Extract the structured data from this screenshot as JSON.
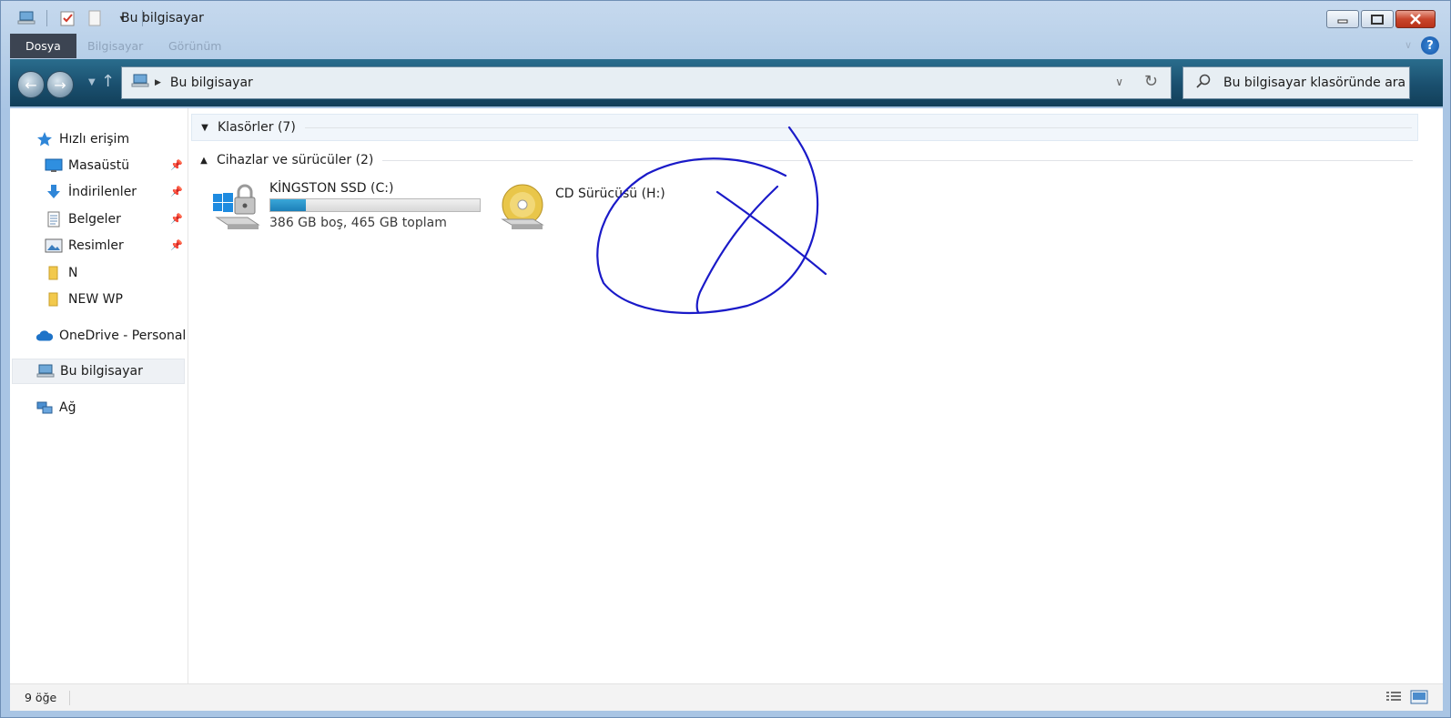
{
  "window": {
    "title": "Bu bilgisayar",
    "controls": [
      "minimize",
      "maximize",
      "close"
    ]
  },
  "ribbon": {
    "tabs": [
      {
        "label": "Dosya",
        "active": true
      },
      {
        "label": "Bilgisayar",
        "active": false
      },
      {
        "label": "Görünüm",
        "active": false
      }
    ],
    "help_label": "?"
  },
  "navbar": {
    "address": "Bu bilgisayar",
    "search_placeholder": "Bu bilgisayar klasöründe ara"
  },
  "sidebar": {
    "quick_access": "Hızlı erişim",
    "items": [
      {
        "label": "Masaüstü",
        "icon": "desktop-icon",
        "pinned": true
      },
      {
        "label": "İndirilenler",
        "icon": "download-icon",
        "pinned": true
      },
      {
        "label": "Belgeler",
        "icon": "document-icon",
        "pinned": true
      },
      {
        "label": "Resimler",
        "icon": "picture-icon",
        "pinned": true
      },
      {
        "label": "N",
        "icon": "folder-icon",
        "pinned": false
      },
      {
        "label": "NEW WP",
        "icon": "folder-icon",
        "pinned": false
      }
    ],
    "onedrive": "OneDrive - Personal",
    "this_pc": "Bu bilgisayar",
    "network": "Ağ"
  },
  "main": {
    "folders_header": "Klasörler (7)",
    "devices_header": "Cihazlar ve sürücüler (2)",
    "drives": [
      {
        "name": "KİNGSTON SSD (C:)",
        "free_text": "386 GB boş, 465 GB toplam",
        "used_fraction": 0.17,
        "icon": "windows-drive-icon"
      },
      {
        "name": "CD Sürücüsü (H:)",
        "icon": "cd-drive-icon"
      }
    ]
  },
  "status": {
    "item_count": "9 öğe"
  },
  "colors": {
    "annotation": "#1a1ac8",
    "accent": "#1c7fb8",
    "navbar": "#1a4f6e"
  }
}
